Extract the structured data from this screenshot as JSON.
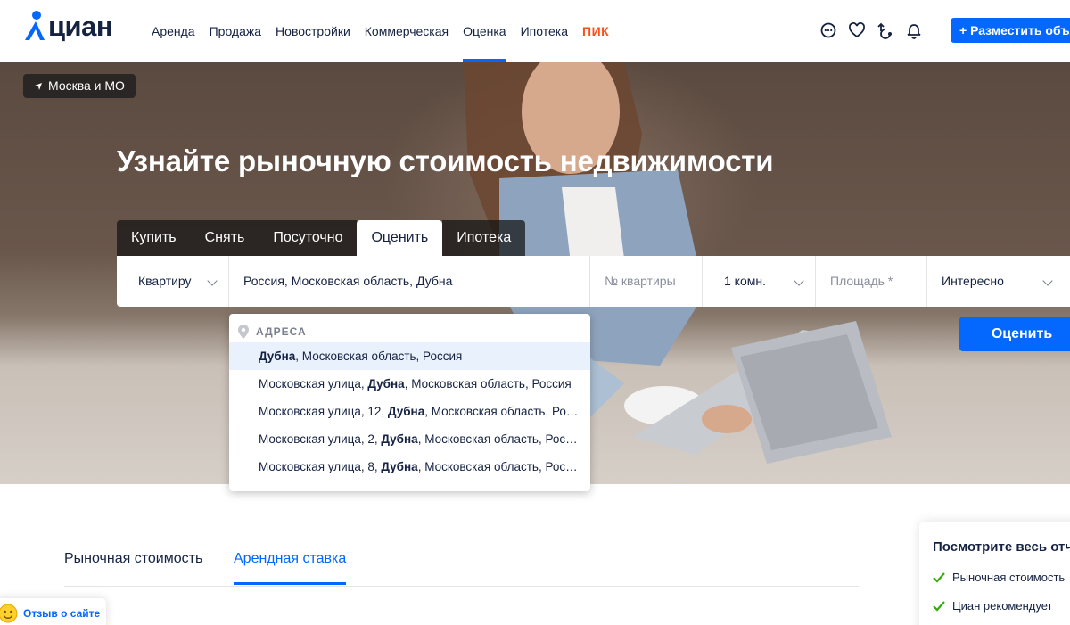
{
  "header": {
    "logo_text": "циан",
    "nav": [
      "Аренда",
      "Продажа",
      "Новостройки",
      "Коммерческая",
      "Оценка",
      "Ипотека",
      "ПИК"
    ],
    "active_nav": "Оценка",
    "icons": [
      "chat-icon",
      "heart-icon",
      "compare-icon",
      "bell-icon"
    ],
    "post_button": "+ Разместить объявление"
  },
  "hero": {
    "region": "Москва и МО",
    "title": "Узнайте рыночную стоимость недвижимости",
    "tabs": [
      "Купить",
      "Снять",
      "Посуточно",
      "Оценить",
      "Ипотека"
    ],
    "active_tab": "Оценить",
    "fields": {
      "object_type": "Квартиру",
      "address": "Россия, Московская область, Дубна",
      "apartment_number_placeholder": "№ квартиры",
      "rooms": "1 комн.",
      "area_placeholder": "Площадь *",
      "purpose": "Интересно"
    },
    "estimate_button": "Оценить"
  },
  "dropdown": {
    "header": "АДРЕСА",
    "items": [
      {
        "prefix": "",
        "bold": "Дубна",
        "suffix": ", Московская область, Россия"
      },
      {
        "prefix": "Московская улица, ",
        "bold": "Дубна",
        "suffix": ", Московская область, Россия"
      },
      {
        "prefix": "Московская улица, 12, ",
        "bold": "Дубна",
        "suffix": ", Московская область, Россия"
      },
      {
        "prefix": "Московская улица, 2, ",
        "bold": "Дубна",
        "suffix": ", Московская область, Россия"
      },
      {
        "prefix": "Московская улица, 8, ",
        "bold": "Дубна",
        "suffix": ", Московская область, Россия"
      }
    ],
    "highlighted_index": 0
  },
  "sub_tabs": {
    "items": [
      "Рыночная стоимость",
      "Арендная ставка"
    ],
    "active": "Арендная ставка"
  },
  "report_card": {
    "title": "Посмотрите весь отчёт",
    "items": [
      "Рыночная стоимость",
      "Циан рекомендует"
    ]
  },
  "feedback": {
    "label": "Отзыв о сайте"
  },
  "colors": {
    "accent": "#0468ff",
    "brand_text": "#152242",
    "pik": "#ff4f12",
    "check": "#34ac0a"
  }
}
